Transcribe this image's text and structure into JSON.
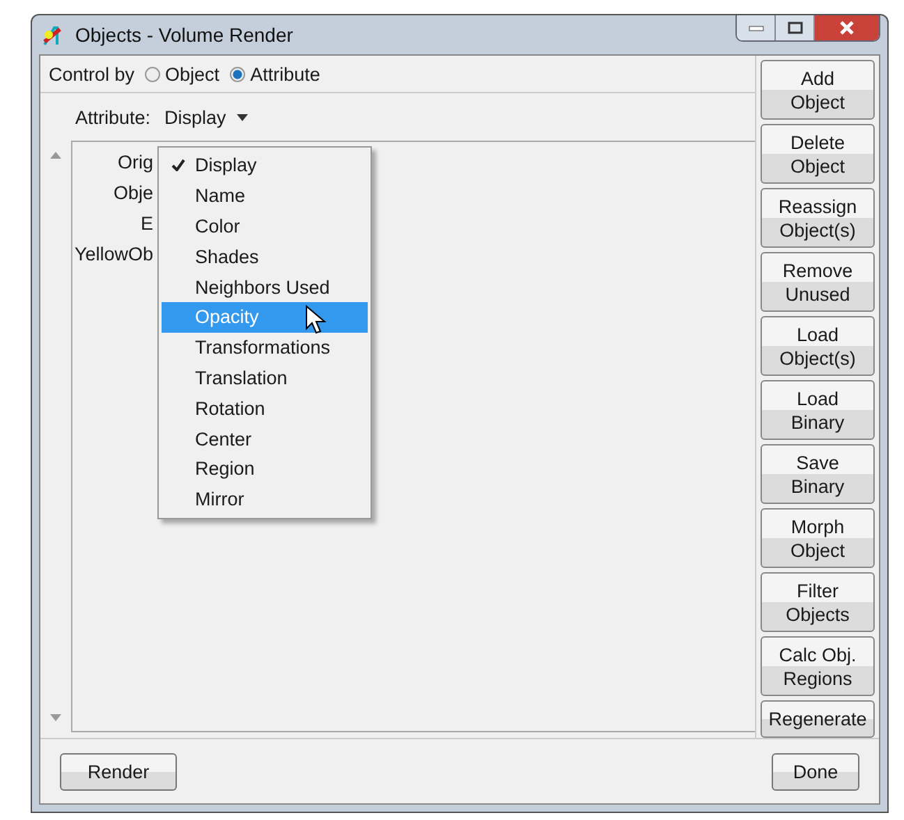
{
  "window": {
    "title": "Objects - Volume Render"
  },
  "control_by": {
    "label": "Control by",
    "options": [
      {
        "label": "Object",
        "selected": false
      },
      {
        "label": "Attribute",
        "selected": true
      }
    ]
  },
  "attribute": {
    "label": "Attribute:",
    "value": "Display"
  },
  "list_rows": [
    "Orig",
    "Obje",
    "E",
    "YellowOb"
  ],
  "menu": [
    {
      "label": "Display",
      "checked": true,
      "selected": false
    },
    {
      "label": "Name",
      "checked": false,
      "selected": false
    },
    {
      "label": "Color",
      "checked": false,
      "selected": false
    },
    {
      "label": "Shades",
      "checked": false,
      "selected": false
    },
    {
      "label": "Neighbors Used",
      "checked": false,
      "selected": false
    },
    {
      "label": "Opacity",
      "checked": false,
      "selected": true
    },
    {
      "label": "Transformations",
      "checked": false,
      "selected": false
    },
    {
      "label": "Translation",
      "checked": false,
      "selected": false
    },
    {
      "label": "Rotation",
      "checked": false,
      "selected": false
    },
    {
      "label": "Center",
      "checked": false,
      "selected": false
    },
    {
      "label": "Region",
      "checked": false,
      "selected": false
    },
    {
      "label": "Mirror",
      "checked": false,
      "selected": false
    }
  ],
  "side_buttons": [
    [
      "Add",
      "Object"
    ],
    [
      "Delete",
      "Object"
    ],
    [
      "Reassign",
      "Object(s)"
    ],
    [
      "Remove",
      "Unused"
    ],
    [
      "Load",
      "Object(s)"
    ],
    [
      "Load",
      "Binary"
    ],
    [
      "Save",
      "Binary"
    ],
    [
      "Morph",
      "Object"
    ],
    [
      "Filter",
      "Objects"
    ],
    [
      "Calc Obj.",
      "Regions"
    ],
    [
      "Regenerate"
    ]
  ],
  "bottom_buttons": [
    "Render",
    "Done"
  ]
}
